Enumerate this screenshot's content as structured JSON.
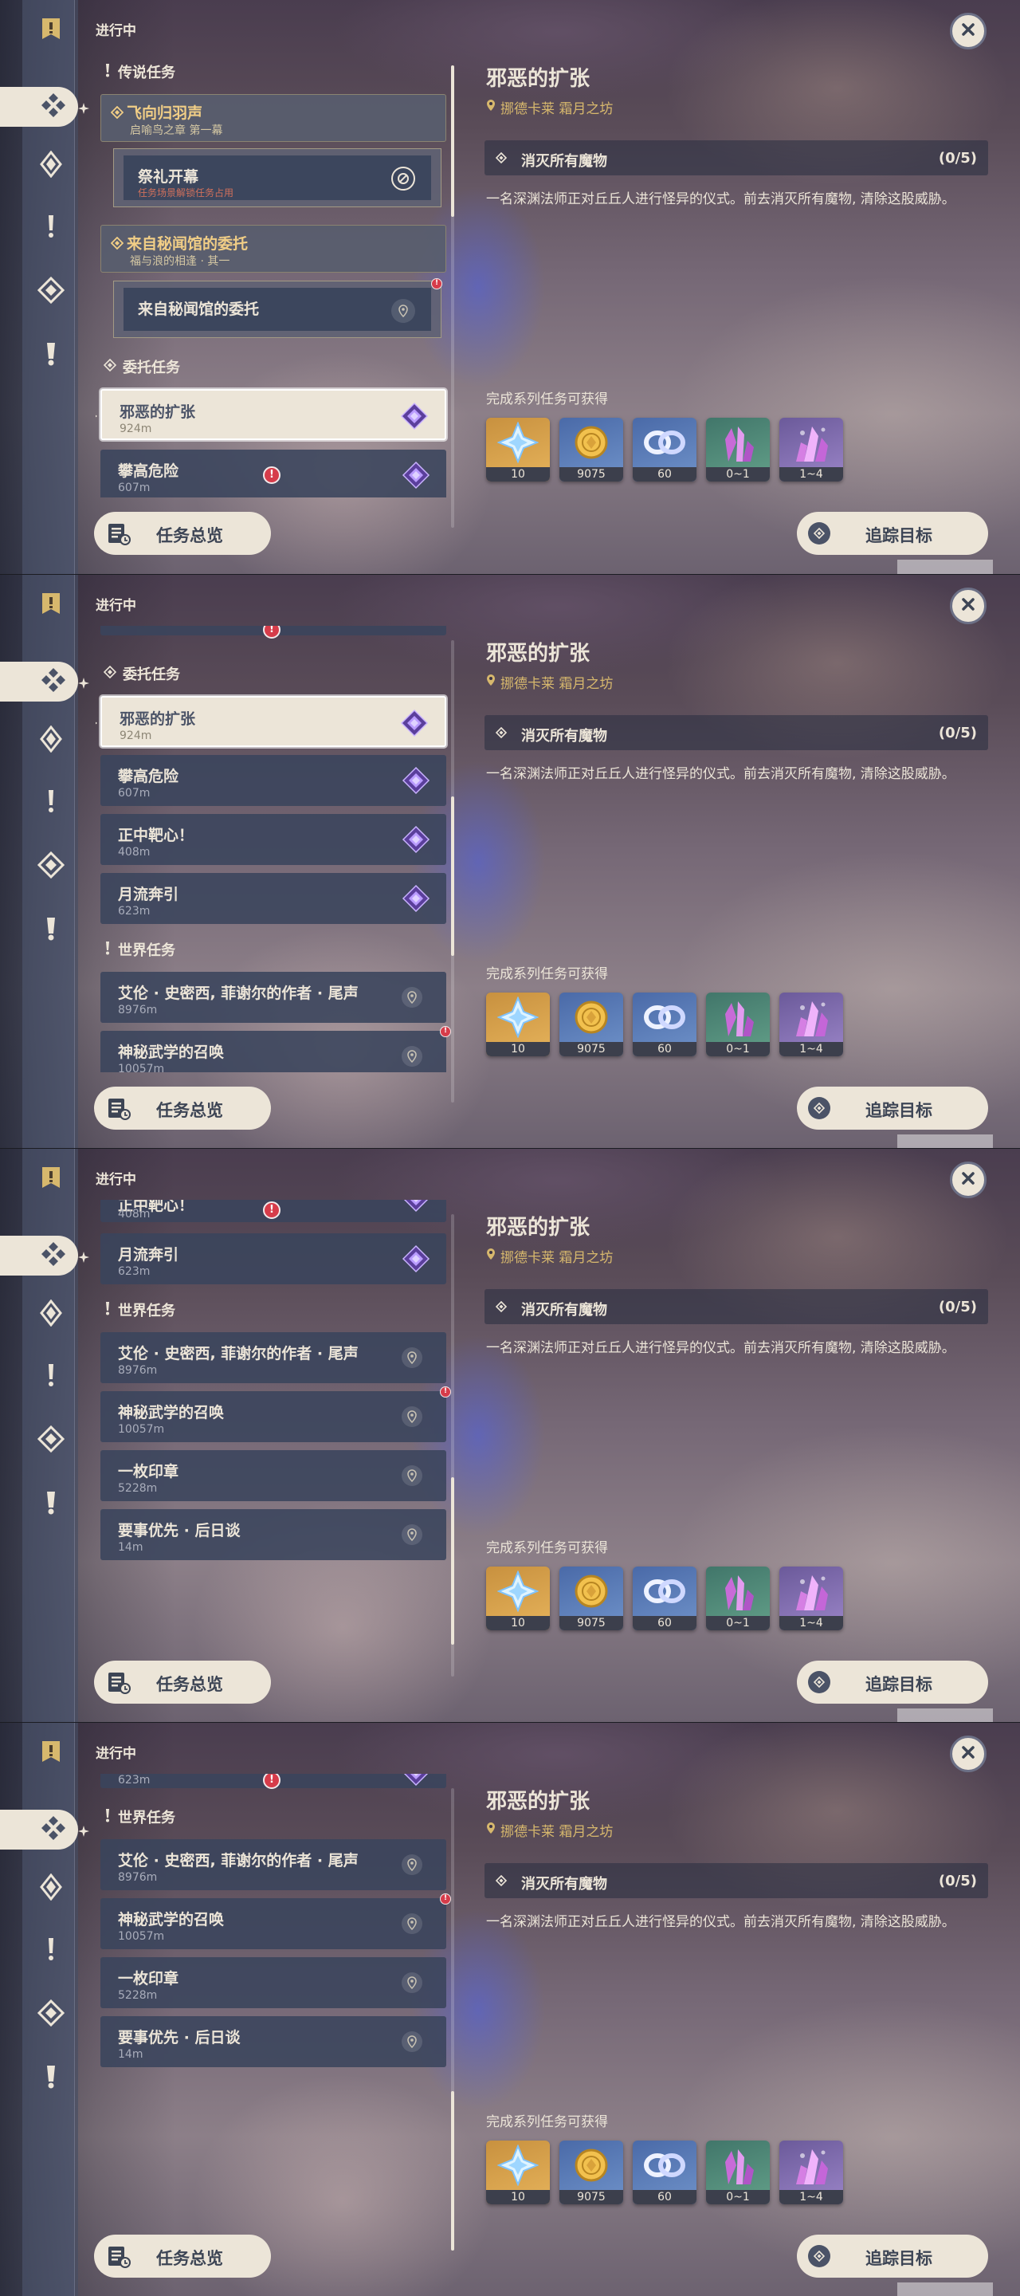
{
  "panel": {
    "title": "进行中",
    "overview_label": "任务总览",
    "track_label": "追踪目标"
  },
  "rail_tabs": [
    {
      "name": "all-quests",
      "icon": "quest-book-icon"
    },
    {
      "name": "archon",
      "icon": "archon-quest-icon"
    },
    {
      "name": "story",
      "icon": "story-quest-icon"
    },
    {
      "name": "world",
      "icon": "world-quest-icon"
    },
    {
      "name": "commission",
      "icon": "commission-quest-icon"
    },
    {
      "name": "event",
      "icon": "event-quest-icon"
    }
  ],
  "categories": {
    "legend": "传说任务",
    "commission": "委托任务",
    "world": "世界任务"
  },
  "legend_quests": [
    {
      "name": "飞向归羽声",
      "chapter": "启喻鸟之章 第一幕",
      "sub": {
        "name": "祭礼开幕",
        "note": "任务场景解锁任务占用"
      }
    },
    {
      "name": "来自秘闻馆的委托",
      "chapter": "福与浪的相逢 · 其一",
      "sub": {
        "name": "来自秘闻馆的委托"
      }
    }
  ],
  "commission_quests": [
    {
      "name": "邪恶的扩张",
      "distance": "924m"
    },
    {
      "name": "攀高危险",
      "distance": "607m"
    },
    {
      "name": "正中靶心！",
      "distance": "408m"
    },
    {
      "name": "月流奔引",
      "distance": "623m"
    }
  ],
  "world_quests": [
    {
      "name": "艾伦 · 史密西, 菲谢尔的作者 · 尾声",
      "distance": "8976m"
    },
    {
      "name": "神秘武学的召唤",
      "distance": "10057m"
    },
    {
      "name": "一枚印章",
      "distance": "5228m"
    },
    {
      "name": "要事优先 · 后日谈",
      "distance": "14m"
    }
  ],
  "detail": {
    "title": "邪恶的扩张",
    "location": "挪德卡莱 霜月之坊",
    "objective": "消灭所有魔物",
    "progress": "(0/5)",
    "description": "一名深渊法师正对丘丘人进行怪异的仪式。前去消灭所有魔物, 清除这股威胁。",
    "rewards_title": "完成系列任务可获得",
    "rewards": [
      {
        "icon": "primogem-icon",
        "count": "10",
        "rarity": 5
      },
      {
        "icon": "mora-icon",
        "count": "9075",
        "rarity": 3
      },
      {
        "icon": "fate-icon",
        "count": "60",
        "rarity": 3
      },
      {
        "icon": "crystal-icon",
        "count": "0~1",
        "rarity": 2
      },
      {
        "icon": "crystal-chunk-icon",
        "count": "1~4",
        "rarity": 4
      }
    ]
  },
  "colors": {
    "accent": "#ece5d8",
    "gold": "#d7b86d",
    "alert": "#d63c4a",
    "item_bg": "#3a445c"
  }
}
